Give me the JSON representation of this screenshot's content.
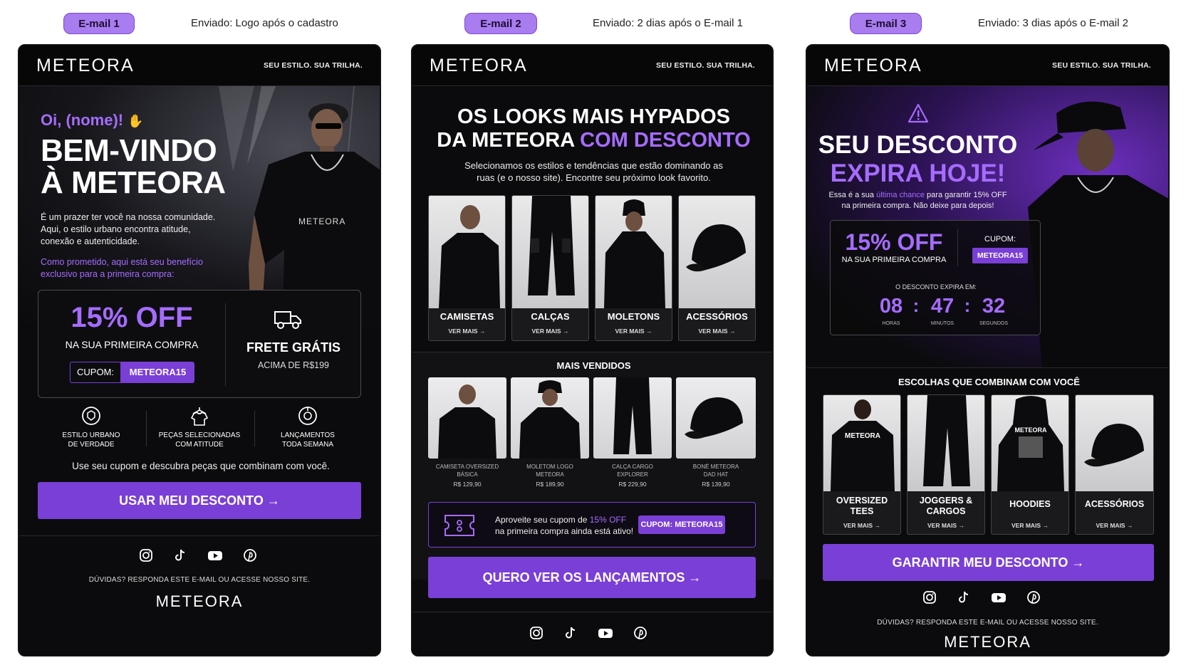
{
  "colors": {
    "accent": "#7a3fd6",
    "accent_text": "#a66cff",
    "background": "#0b0b0d"
  },
  "brand": {
    "logo": "METEORA",
    "slogan": "SEU ESTILO. SUA TRILHA."
  },
  "email1": {
    "tag": "E-mail 1",
    "sent": "Enviado: Logo após o cadastro",
    "greeting": "Oi, (nome)!",
    "greeting_icon": "waving-hand-icon",
    "title_l1": "BEM-VINDO",
    "title_l2": "À METEORA",
    "shirt_print": "METEORA",
    "intro": "É um prazer ter você na nossa comunidade. Aqui, o estilo urbano encontra atitude, conexão e autenticidade.",
    "promise": "Como prometido, aqui está seu benefício exclusivo para a primeira compra:",
    "off": "15% OFF",
    "off_sub": "NA SUA PRIMEIRA COMPRA",
    "coupon_label": "CUPOM:",
    "coupon_code": "METEORA15",
    "shipping_icon": "truck-icon",
    "shipping_title": "FRETE GRÁTIS",
    "shipping_sub": "ACIMA DE R$199",
    "features": [
      {
        "icon": "shield-icon",
        "l1": "ESTILO URBANO",
        "l2": "DE VERDADE"
      },
      {
        "icon": "hanger-shirt-icon",
        "l1": "PEÇAS SELECIONADAS",
        "l2": "COM ATITUDE"
      },
      {
        "icon": "launch-icon",
        "l1": "LANÇAMENTOS",
        "l2": "TODA SEMANA"
      }
    ],
    "cta_note": "Use seu cupom e descubra peças que combinam com você.",
    "cta": "USAR MEU DESCONTO →",
    "footer_note": "DÚVIDAS? RESPONDA ESTE E-MAIL OU ACESSE NOSSO SITE."
  },
  "email2": {
    "tag": "E-mail 2",
    "sent": "Enviado: 2 dias após o E-mail 1",
    "title_l1": "OS LOOKS MAIS HYPADOS",
    "title_l2a": "DA METEORA ",
    "title_l2b": "COM DESCONTO",
    "subtitle": "Selecionamos os estilos e tendências que estão dominando as ruas (e o nosso site). Encontre seu próximo look favorito.",
    "categories": [
      {
        "label": "CAMISETAS",
        "more": "VER MAIS →"
      },
      {
        "label": "CALÇAS",
        "more": "VER MAIS →"
      },
      {
        "label": "MOLETONS",
        "more": "VER MAIS →"
      },
      {
        "label": "ACESSÓRIOS",
        "more": "VER MAIS →"
      }
    ],
    "best_title": "MAIS VENDIDOS",
    "products": [
      {
        "l1": "CAMISETA OVERSIZED",
        "l2": "BÁSICA",
        "price": "R$ 129,90"
      },
      {
        "l1": "MOLETOM LOGO",
        "l2": "METEORA",
        "price": "R$ 189,90"
      },
      {
        "l1": "CALÇA CARGO",
        "l2": "EXPLORER",
        "price": "R$ 229,90"
      },
      {
        "l1": "BONÉ METEORA",
        "l2": "DAD HAT",
        "price": "R$ 139,90"
      }
    ],
    "reminder_a": "Aproveite seu cupom de ",
    "reminder_b": "15% OFF",
    "reminder_c": "na primeira compra ainda está ativo!",
    "coupon_label": "CUPOM:",
    "coupon_code": "METEORA15",
    "cta": "QUERO VER OS LANÇAMENTOS →"
  },
  "email3": {
    "tag": "E-mail 3",
    "sent": "Enviado: 3 dias após o E-mail 2",
    "warning_icon": "warning-icon",
    "title_l1": "SEU DESCONTO",
    "title_l2": "EXPIRA HOJE!",
    "body_a": "Essa é a sua ",
    "body_b": "última chance",
    "body_c": " para garantir 15% OFF",
    "body_d": "na primeira compra. Não deixe para depois!",
    "off": "15% OFF",
    "off_sub": "NA SUA PRIMEIRA COMPRA",
    "coupon_label": "CUPOM:",
    "coupon_code": "METEORA15",
    "expire_label": "O DESCONTO EXPIRA EM:",
    "hours": "08",
    "minutes": "47",
    "seconds": "32",
    "hours_lbl": "HORAS",
    "minutes_lbl": "MINUTOS",
    "seconds_lbl": "SEGUNDOS",
    "picks_title": "ESCOLHAS QUE COMBINAM COM VOCÊ",
    "picks": [
      {
        "l1": "OVERSIZED",
        "l2": "TEES",
        "more": "VER MAIS →"
      },
      {
        "l1": "JOGGERS &",
        "l2": "CARGOS",
        "more": "VER MAIS →"
      },
      {
        "l1": "HOODIES",
        "l2": "",
        "more": "VER MAIS →"
      },
      {
        "l1": "ACESSÓRIOS",
        "l2": "",
        "more": "VER MAIS →"
      }
    ],
    "cta": "GARANTIR MEU DESCONTO →",
    "footer_note": "DÚVIDAS? RESPONDA ESTE E-MAIL OU ACESSE NOSSO SITE."
  },
  "social": [
    "instagram-icon",
    "tiktok-icon",
    "youtube-icon",
    "pinterest-icon"
  ]
}
